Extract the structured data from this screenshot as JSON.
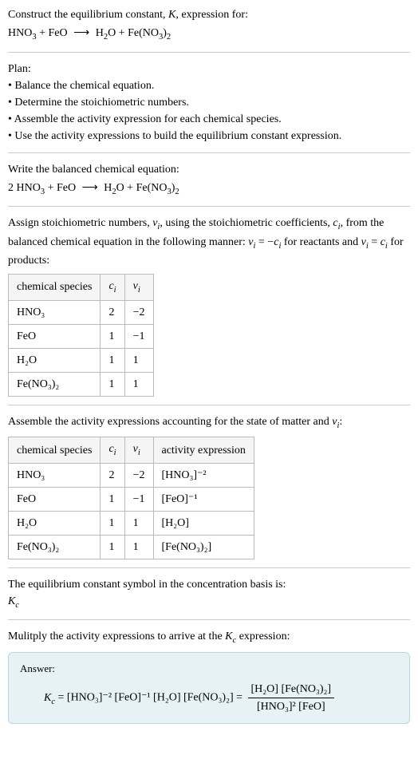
{
  "title": {
    "line1_prefix": "Construct the equilibrium constant, ",
    "K": "K",
    "line1_suffix": ", expression for:",
    "equation_lhs1": "HNO",
    "equation_lhs2": " + FeO",
    "arrow": "⟶",
    "equation_rhs1": "H",
    "equation_rhs2": "O + Fe(NO",
    "equation_rhs3": ")"
  },
  "plan": {
    "heading": "Plan:",
    "b1": "• Balance the chemical equation.",
    "b2": "• Determine the stoichiometric numbers.",
    "b3": "• Assemble the activity expression for each chemical species.",
    "b4": "• Use the activity expressions to build the equilibrium constant expression."
  },
  "balanced": {
    "heading": "Write the balanced chemical equation:",
    "lhs": "2 HNO",
    "lhs2": " + FeO",
    "arrow": "⟶",
    "rhs1": "H",
    "rhs2": "O + Fe(NO",
    "rhs3": ")"
  },
  "assign": {
    "text1": "Assign stoichiometric numbers, ",
    "nu_i": "ν",
    "text2": ", using the stoichiometric coefficients, ",
    "c_i": "c",
    "text3": ", from the balanced chemical equation in the following manner: ",
    "eq1": " = −",
    "text4": " for reactants and ",
    "eq2": " = ",
    "text5": " for products:"
  },
  "table1": {
    "h1": "chemical species",
    "h2": "c",
    "h3": "ν",
    "rows": [
      {
        "species": "HNO₃",
        "c": "2",
        "nu": "−2"
      },
      {
        "species": "FeO",
        "c": "1",
        "nu": "−1"
      },
      {
        "species": "H₂O",
        "c": "1",
        "nu": "1"
      },
      {
        "species": "Fe(NO₃)₂",
        "c": "1",
        "nu": "1"
      }
    ]
  },
  "assemble": {
    "text1": "Assemble the activity expressions accounting for the state of matter and ",
    "text2": ":"
  },
  "table2": {
    "h1": "chemical species",
    "h2": "c",
    "h3": "ν",
    "h4": "activity expression",
    "rows": [
      {
        "species": "HNO₃",
        "c": "2",
        "nu": "−2",
        "act": "[HNO₃]⁻²"
      },
      {
        "species": "FeO",
        "c": "1",
        "nu": "−1",
        "act": "[FeO]⁻¹"
      },
      {
        "species": "H₂O",
        "c": "1",
        "nu": "1",
        "act": "[H₂O]"
      },
      {
        "species": "Fe(NO₃)₂",
        "c": "1",
        "nu": "1",
        "act": "[Fe(NO₃)₂]"
      }
    ]
  },
  "symbol": {
    "text": "The equilibrium constant symbol in the concentration basis is:",
    "kc": "K",
    "kc_sub": "c"
  },
  "multiply": {
    "text1": "Mulitply the activity expressions to arrive at the ",
    "text2": " expression:"
  },
  "answer": {
    "label": "Answer:",
    "kc": "K",
    "kc_sub": "c",
    "eq": " = [HNO₃]⁻² [FeO]⁻¹ [H₂O] [Fe(NO₃)₂] = ",
    "num": "[H₂O] [Fe(NO₃)₂]",
    "den": "[HNO₃]² [FeO]"
  },
  "chart_data": {
    "type": "table",
    "tables": [
      {
        "title": "Stoichiometric numbers",
        "columns": [
          "chemical species",
          "c_i",
          "ν_i"
        ],
        "rows": [
          [
            "HNO3",
            2,
            -2
          ],
          [
            "FeO",
            1,
            -1
          ],
          [
            "H2O",
            1,
            1
          ],
          [
            "Fe(NO3)2",
            1,
            1
          ]
        ]
      },
      {
        "title": "Activity expressions",
        "columns": [
          "chemical species",
          "c_i",
          "ν_i",
          "activity expression"
        ],
        "rows": [
          [
            "HNO3",
            2,
            -2,
            "[HNO3]^-2"
          ],
          [
            "FeO",
            1,
            -1,
            "[FeO]^-1"
          ],
          [
            "H2O",
            1,
            1,
            "[H2O]"
          ],
          [
            "Fe(NO3)2",
            1,
            1,
            "[Fe(NO3)2]"
          ]
        ]
      }
    ]
  }
}
